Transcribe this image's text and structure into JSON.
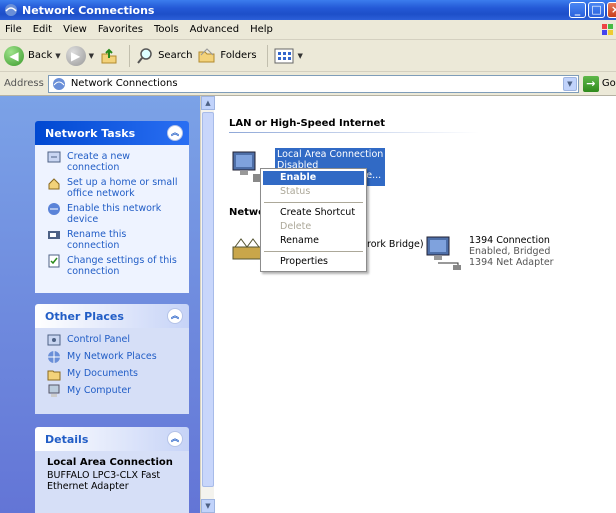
{
  "window": {
    "title": "Network Connections"
  },
  "menu": [
    "File",
    "Edit",
    "View",
    "Favorites",
    "Tools",
    "Advanced",
    "Help"
  ],
  "toolbar": {
    "back": "Back",
    "search": "Search",
    "folders": "Folders"
  },
  "address": {
    "label": "Address",
    "value": "Network Connections",
    "go": "Go"
  },
  "network_tasks": {
    "title": "Network Tasks",
    "items": [
      "Create a new connection",
      "Set up a home or small office network",
      "Enable this network device",
      "Rename this connection",
      "Change settings of this connection"
    ]
  },
  "other_places": {
    "title": "Other Places",
    "items": [
      "Control Panel",
      "My Network Places",
      "My Documents",
      "My Computer"
    ]
  },
  "details": {
    "title": "Details",
    "name": "Local Area Connection",
    "description": "BUFFALO LPC3-CLX Fast Ethernet Adapter"
  },
  "groups": {
    "lan": "LAN or High-Speed Internet",
    "network": "Networ"
  },
  "connections": {
    "lan": {
      "name": "Local Area Connection",
      "status": "Disabled",
      "device": "ast Ethe..."
    },
    "bridge": {
      "name": "rork Bridge)"
    },
    "c1394": {
      "name": "1394 Connection",
      "status": "Enabled, Bridged",
      "device": "1394 Net Adapter"
    }
  },
  "context_menu": {
    "enable": "Enable",
    "status": "Status",
    "create_shortcut": "Create Shortcut",
    "delete": "Delete",
    "rename": "Rename",
    "properties": "Properties"
  },
  "colors": {
    "titlebar": "#2459d6",
    "selection": "#316ac5",
    "task_link": "#215dc6"
  }
}
